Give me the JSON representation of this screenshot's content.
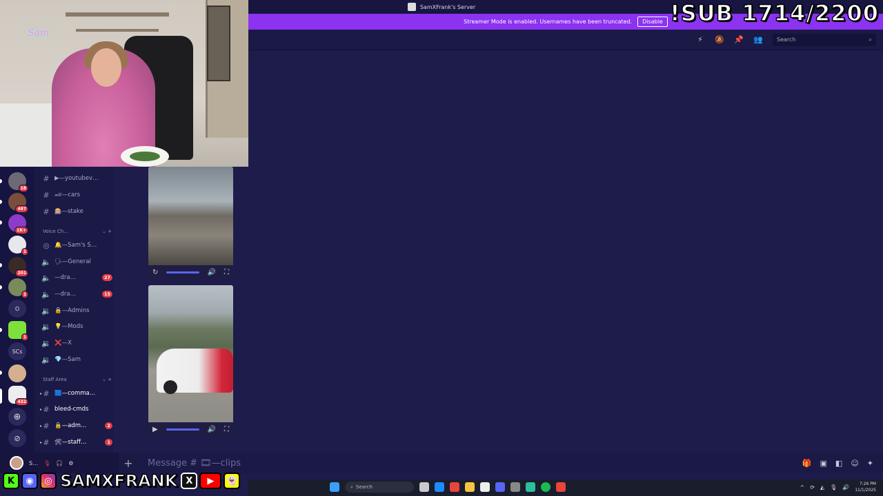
{
  "titlebar": {
    "title": "SamXFrank's Server"
  },
  "overlay": {
    "sub_goal": "!SUB 1714/2200",
    "neon": "Sam"
  },
  "banner": {
    "message": "Streamer Mode is enabled. Usernames have been truncated.",
    "disable_label": "Disable"
  },
  "header": {
    "search_placeholder": "Search"
  },
  "servers": [
    {
      "badge": "18"
    },
    {
      "badge": "487"
    },
    {
      "badge": "1K+"
    },
    {
      "badge": "1"
    },
    {
      "badge": "201"
    },
    {
      "badge": "1"
    },
    {
      "label": "O"
    },
    {
      "badge": "1"
    },
    {
      "label": "SCs"
    },
    {
      "badge": ""
    },
    {
      "badge": "432"
    }
  ],
  "channels": [
    {
      "icon": "#",
      "label": "▶—youtubev…",
      "badge": ""
    },
    {
      "icon": "#",
      "label": "🏎—cars",
      "badge": ""
    },
    {
      "icon": "#",
      "label": "🎰—stake",
      "badge": ""
    }
  ],
  "voice_category": "Voice Ch…",
  "voice_channels": [
    {
      "label": "🔔—Sam's S…",
      "badge": ""
    },
    {
      "label": "🗣—General",
      "badge": ""
    },
    {
      "label": "—dra…",
      "badge": "27"
    },
    {
      "label": "—dra…",
      "badge": "15"
    },
    {
      "label": "🔒—Admins",
      "badge": ""
    },
    {
      "label": "💡—Mods",
      "badge": ""
    },
    {
      "label": "❌—X",
      "badge": ""
    },
    {
      "label": "💎—Sam",
      "badge": ""
    }
  ],
  "staff_category": "Staff Area",
  "staff_channels": [
    {
      "label": "🟦—comma…",
      "badge": ""
    },
    {
      "label": "bleed-cmds",
      "badge": ""
    },
    {
      "label": "🔒—adm…",
      "badge": "2"
    },
    {
      "label": "🛠—staff…",
      "badge": "1"
    }
  ],
  "message_bar": {
    "placeholder": "Message # 🎞—clips"
  },
  "user": {
    "name": "S…"
  },
  "social": {
    "handle": "SAMXFRANK"
  },
  "taskbar": {
    "search": "Search",
    "time": "7:26 PM",
    "date": "11/1/2025"
  }
}
